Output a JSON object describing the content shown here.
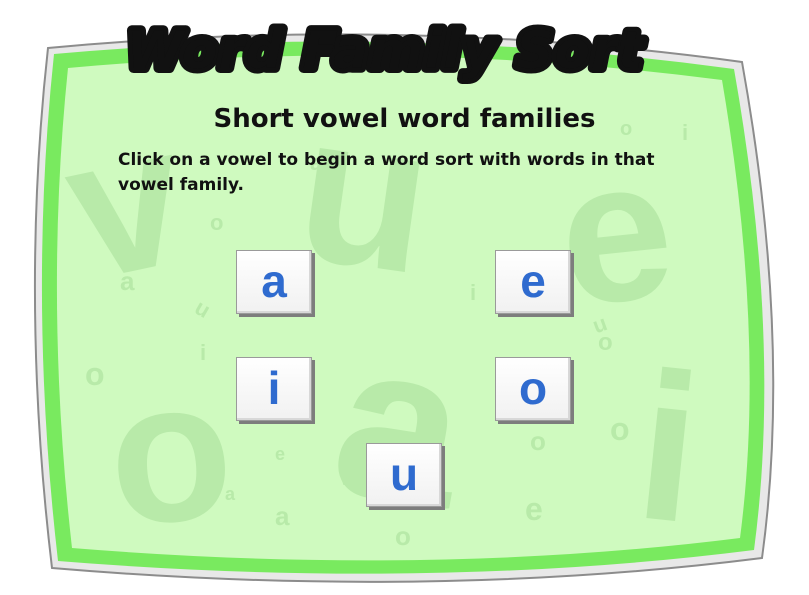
{
  "header": {
    "title": "Word Family Sort"
  },
  "panel": {
    "subtitle": "Short vowel word families",
    "instructions": "Click on a vowel to begin a word sort with words in that vowel family."
  },
  "vowels": [
    {
      "label": "a"
    },
    {
      "label": "e"
    },
    {
      "label": "i"
    },
    {
      "label": "o"
    },
    {
      "label": "u"
    }
  ],
  "colors": {
    "panel_fill": "#cffabf",
    "panel_border": "#79ea5f",
    "button_text": "#2f6bcf",
    "watermark": "#b5e9a6"
  }
}
